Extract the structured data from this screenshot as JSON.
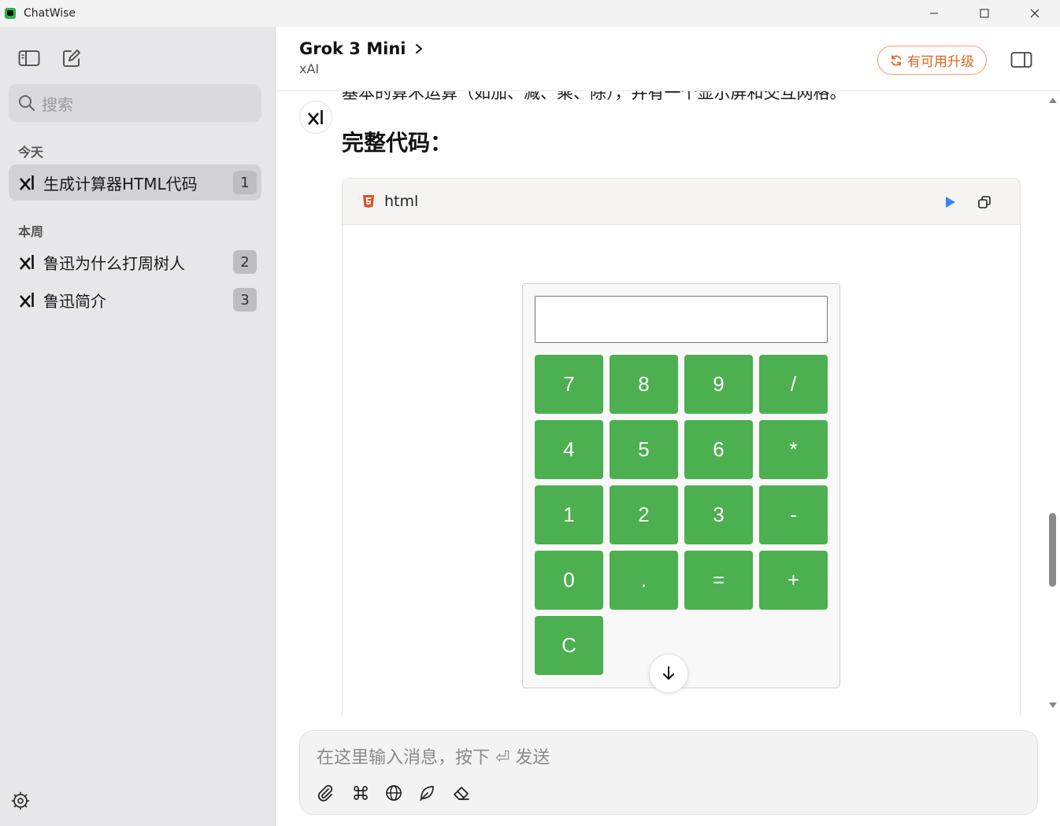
{
  "app": {
    "title": "ChatWise"
  },
  "sidebar": {
    "search_placeholder": "搜索",
    "sections": [
      {
        "label": "今天",
        "items": [
          {
            "title": "生成计算器HTML代码",
            "badge": "1",
            "active": true
          }
        ]
      },
      {
        "label": "本周",
        "items": [
          {
            "title": "鲁迅为什么打周树人",
            "badge": "2",
            "active": false
          },
          {
            "title": "鲁迅简介",
            "badge": "3",
            "active": false
          }
        ]
      }
    ]
  },
  "header": {
    "model": "Grok 3 Mini",
    "provider": "xAI",
    "upgrade_label": "有可用升级"
  },
  "message": {
    "partial_line": "基本的算术运算（如加、减、乘、除），并有一个显示屏和交互网格。",
    "heading": "完整代码：",
    "code_block": {
      "language": "html"
    },
    "calculator": {
      "display_value": "",
      "keys": [
        [
          "7",
          "8",
          "9",
          "/"
        ],
        [
          "4",
          "5",
          "6",
          "*"
        ],
        [
          "1",
          "2",
          "3",
          "-"
        ],
        [
          "0",
          ".",
          "=",
          "+"
        ],
        [
          "C"
        ]
      ],
      "key_color": "#4caf50"
    }
  },
  "composer": {
    "placeholder": "在这里输入消息，按下 ⏎ 发送"
  },
  "colors": {
    "accent_orange": "#e4641e",
    "run_blue": "#3b82f6",
    "html5_orange": "#e44d26"
  }
}
